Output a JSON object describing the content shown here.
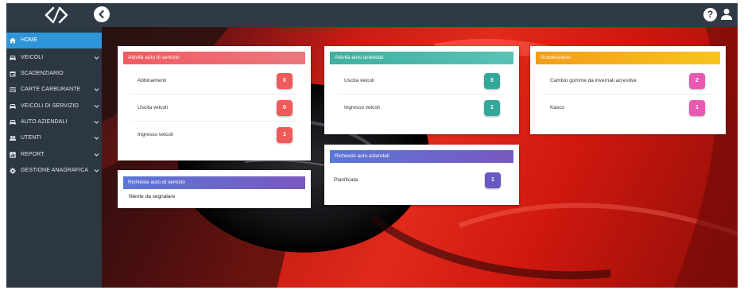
{
  "colors": {
    "sidebar_bg": "#2c3742",
    "topbar_bg": "#2f3a46",
    "active_item": "#2e95d8",
    "red_header": [
      "#f35a62",
      "#e9787d"
    ],
    "teal_header": [
      "#3fb0a0",
      "#5bc2b5"
    ],
    "orange_header": [
      "#f29d1b",
      "#f7c51f"
    ],
    "purple_header": [
      "#5b77d6",
      "#7a58bf"
    ],
    "red_badge": "#ef5a5a",
    "teal_badge": "#34a79b",
    "pink_badge": "#e85ab2",
    "purple_badge": "#6659c6"
  },
  "topbar": {
    "logo_icon": "code-brackets-logo",
    "collapse_icon": "chevron-left-icon",
    "help_label": "?",
    "user_icon": "user-icon"
  },
  "sidebar": {
    "items": [
      {
        "label": "HOME",
        "icon": "home-icon",
        "chevron": false,
        "active": true
      },
      {
        "label": "VEICOLI",
        "icon": "car-icon",
        "chevron": true
      },
      {
        "label": "SCADENZIARIO",
        "icon": "calendar-icon",
        "chevron": false
      },
      {
        "label": "CARTE CARBURANTE",
        "icon": "credit-card-icon",
        "chevron": true
      },
      {
        "label": "VEICOLI DI SERVIZIO",
        "icon": "car-icon",
        "chevron": true
      },
      {
        "label": "AUTO AZIENDALI",
        "icon": "car-icon",
        "chevron": true
      },
      {
        "label": "UTENTI",
        "icon": "people-icon",
        "chevron": true
      },
      {
        "label": "REPORT",
        "icon": "report-icon",
        "chevron": true
      },
      {
        "label": "GESTIONE ANAGRAFICA",
        "icon": "gear-icon",
        "chevron": true
      }
    ]
  },
  "cards": {
    "servizio": {
      "title": "Attività auto di servizio",
      "rows": [
        {
          "label": "Abbinamenti",
          "value": "0"
        },
        {
          "label": "Uscita veicoli",
          "value": "0"
        },
        {
          "label": "Ingresso veicoli",
          "value": "1"
        }
      ]
    },
    "aziendali": {
      "title": "Attività auto aziendali",
      "rows": [
        {
          "label": "Uscita veicoli",
          "value": "5"
        },
        {
          "label": "Ingresso veicoli",
          "value": "1"
        }
      ]
    },
    "scadenziario": {
      "title": "Scadenziario",
      "rows": [
        {
          "label": "Cambio gomme da invernali ad estive",
          "value": "2"
        },
        {
          "label": "Kasco",
          "value": "1"
        }
      ]
    },
    "richieste_servizio": {
      "title": "Richieste auto di servizio",
      "empty_text": "Niente da segnalare"
    },
    "richieste_aziendali": {
      "title": "Richieste auto aziendali",
      "rows": [
        {
          "label": "Pianificata",
          "value": "1"
        }
      ]
    }
  }
}
